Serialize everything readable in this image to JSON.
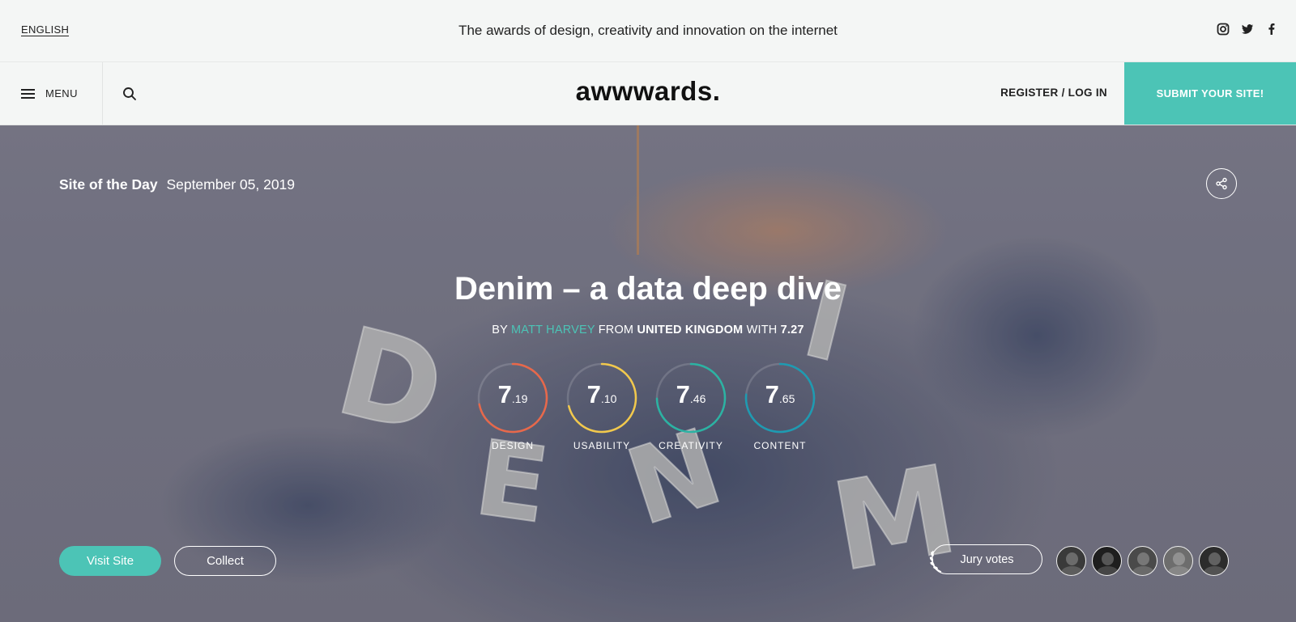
{
  "topbar": {
    "language": "ENGLISH",
    "tagline": "The awards of design, creativity and innovation on the internet",
    "social": [
      "instagram-icon",
      "twitter-icon",
      "facebook-icon"
    ]
  },
  "nav": {
    "menu_label": "MENU",
    "logo": "awwwards.",
    "register_label": "REGISTER / LOG IN",
    "submit_label": "SUBMIT YOUR SITE!"
  },
  "hero": {
    "award": "Site of the Day",
    "date": "September 05, 2019",
    "title": "Denim – a data deep dive",
    "byline": {
      "by": "BY",
      "author": "MATT HARVEY",
      "from": "FROM",
      "country": "UNITED KINGDOM",
      "with": "WITH",
      "score": "7.27"
    },
    "scores": [
      {
        "int": "7",
        "dec": ".19",
        "label": "DESIGN",
        "value": 7.19,
        "color": "#e8684a"
      },
      {
        "int": "7",
        "dec": ".10",
        "label": "USABILITY",
        "value": 7.1,
        "color": "#f2c94c"
      },
      {
        "int": "7",
        "dec": ".46",
        "label": "CREATIVITY",
        "value": 7.46,
        "color": "#2bb3a3"
      },
      {
        "int": "7",
        "dec": ".65",
        "label": "CONTENT",
        "value": 7.65,
        "color": "#1d9bb2"
      }
    ],
    "letters": [
      "D",
      "E",
      "N",
      "I",
      "M"
    ],
    "visit_label": "Visit Site",
    "collect_label": "Collect",
    "jury_label": "Jury votes",
    "jury_count": 5
  },
  "colors": {
    "accent": "#4cc4b6"
  }
}
